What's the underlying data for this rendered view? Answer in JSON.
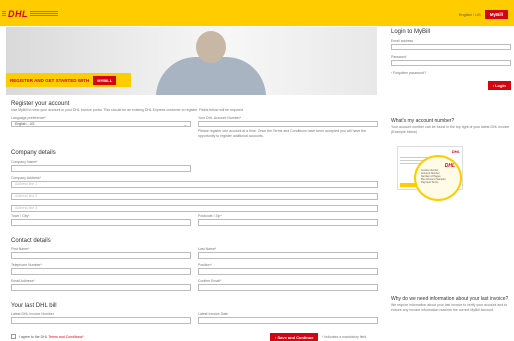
{
  "header": {
    "logo_text": "DHL",
    "language_text": "English / US",
    "mybill_label": "MyBill"
  },
  "hero": {
    "banner_text": "REGISTER AND GET STARTED WITH",
    "banner_button": "MYBILL"
  },
  "login": {
    "title": "Login to MyBill",
    "email_label": "Email address",
    "password_label": "Password",
    "forgot_label": "Forgotten password?",
    "login_button": "Login"
  },
  "register": {
    "title": "Register your account",
    "intro": "Use MyBill to view your account in your DHL Invoice portal. This should be an existing DHL Express customer to register. Fields below will be required.",
    "language_label": "Language preference*",
    "language_value": "English - US",
    "account_label": "Your DHL Account Number*",
    "account_help": "Please register one account at a time. Once the Terms and Conditions have been accepted you will have the opportunity to register additional accounts."
  },
  "company": {
    "title": "Company details",
    "name_label": "Company Name*",
    "address_label": "Company Address*",
    "address_lines": [
      "Address line 1",
      "Address line 2",
      "Address line 3"
    ],
    "town_label": "Town / City*",
    "postcode_label": "Postcode / Zip*"
  },
  "contact": {
    "title": "Contact details",
    "first_label": "First Name*",
    "last_label": "Last Name*",
    "telephone_label": "Telephone Number*",
    "position_label": "Position*",
    "email_label": "Email Address*",
    "confirm_label": "Confirm Email*"
  },
  "bill": {
    "title": "Your last DHL bill",
    "invoice_label": "Latest DHL Invoice Number",
    "date_label": "Latest Invoice Date"
  },
  "aside": {
    "account_title": "What's my account number?",
    "account_text": "Your account number can be found in the top right of your latest DHL invoice (Example below)",
    "invoice_logo": "DHL",
    "zoom_lines": [
      "Invoice Number",
      "Account Number",
      "Number of Pages",
      "Due Amount (Sample)",
      "Payment Terms"
    ],
    "why_title": "Why do we need information about your last invoice?",
    "why_text": "We require information about your last invoice to verify your account and to ensure any invoice information reaches the correct MyBill account."
  },
  "footer": {
    "terms_text": "I agree to the DHL",
    "terms_link": "Terms and Conditions*",
    "submit_label": "Save and Continue",
    "required_note": "* Indicates a mandatory field"
  },
  "colors": {
    "brand_yellow": "#ffcc00",
    "brand_red": "#d40511"
  }
}
